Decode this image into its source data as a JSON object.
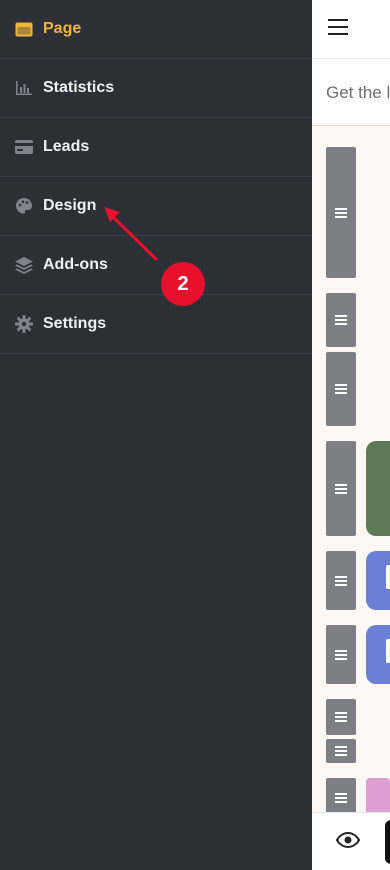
{
  "sidebar": {
    "items": [
      {
        "label": "Page",
        "icon": "browser-window-icon",
        "active": true
      },
      {
        "label": "Statistics",
        "icon": "bar-chart-icon"
      },
      {
        "label": "Leads",
        "icon": "credit-card-icon"
      },
      {
        "label": "Design",
        "icon": "palette-icon"
      },
      {
        "label": "Add-ons",
        "icon": "layers-icon"
      },
      {
        "label": "Settings",
        "icon": "gear-icon"
      }
    ]
  },
  "main": {
    "subbar_text": "Get the l"
  },
  "annotation": {
    "step_number": "2",
    "color": "#e8112d"
  },
  "colors": {
    "sidebar_bg": "#2c2f36",
    "active": "#f2b53a",
    "handle": "#7d7f84",
    "block_green": "#5f7a57",
    "block_blue": "#6b7fd6",
    "block_pink": "#de9fd1"
  }
}
